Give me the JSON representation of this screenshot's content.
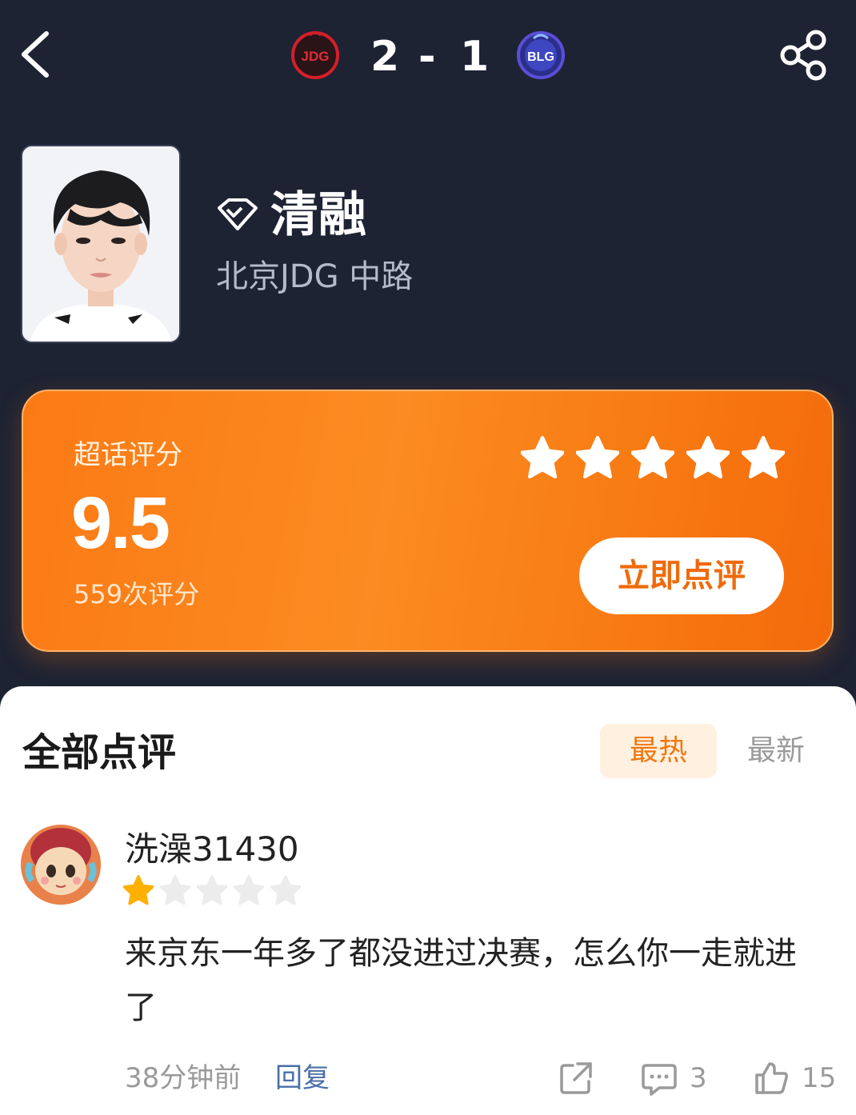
{
  "header": {
    "team_left": "JDG",
    "team_right": "BLG",
    "score_left": "2",
    "score_separator": "-",
    "score_right": "1"
  },
  "player": {
    "name": "清融",
    "team_position": "北京JDG 中路"
  },
  "rating": {
    "label": "超话评分",
    "score": "9.5",
    "count_text": "559次评分",
    "stars": 5,
    "rate_button": "立即点评"
  },
  "reviews": {
    "title": "全部点评",
    "sort_hot": "最热",
    "sort_new": "最新",
    "items": [
      {
        "username": "洗澡31430",
        "stars": 1,
        "text": "来京东一年多了都没进过决赛，怎么你一走就进了",
        "time": "38分钟前",
        "reply": "回复",
        "comments": "3",
        "likes": "15"
      }
    ]
  },
  "colors": {
    "background": "#1d2333",
    "accent_orange": "#fb7a15",
    "star_gold": "#ffb000",
    "link_blue": "#4a6ea8"
  }
}
